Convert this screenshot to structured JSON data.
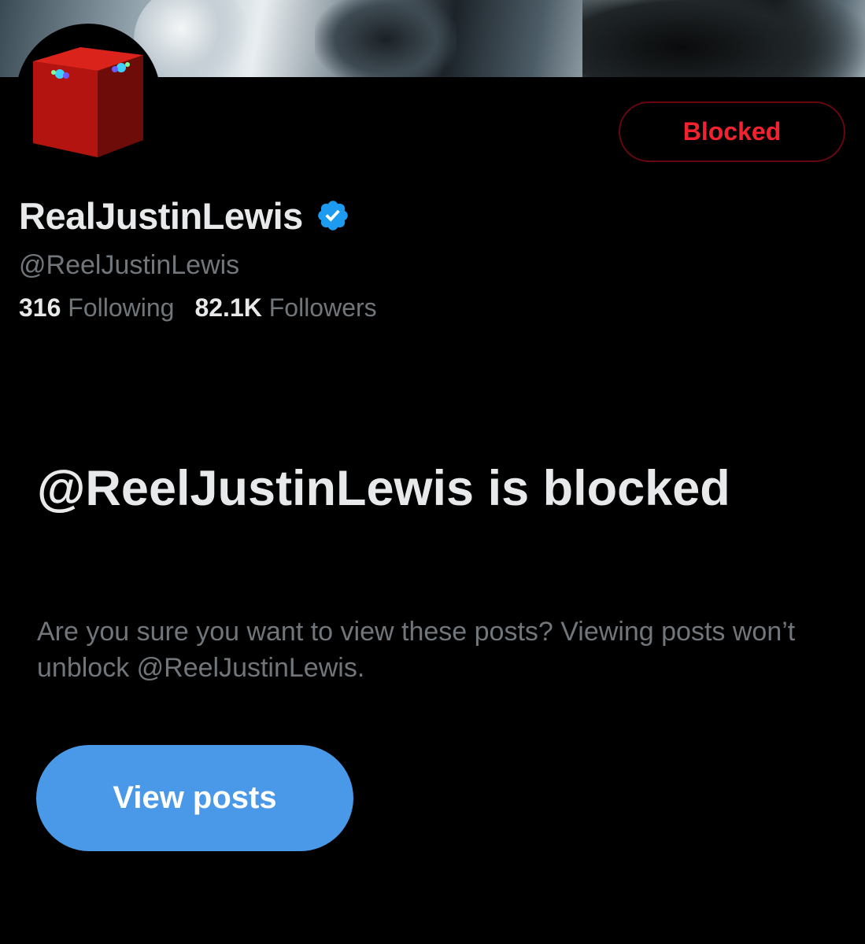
{
  "profile": {
    "display_name": "RealJustinLewis",
    "handle": "@ReelJustinLewis",
    "verified_icon": "verified-badge-icon",
    "avatar_icon": "red-cube-avatar",
    "following_count": "316",
    "following_label": "Following",
    "followers_count": "82.1K",
    "followers_label": "Followers"
  },
  "actions": {
    "blocked_label": "Blocked",
    "view_posts_label": "View posts"
  },
  "block_notice": {
    "title": "@ReelJustinLewis is blocked",
    "description": "Are you sure you want to view these posts? Viewing posts won’t unblock @ReelJustinLewis."
  },
  "colors": {
    "background": "#000000",
    "primary_text": "#e7e9ea",
    "secondary_text": "#71767b",
    "blocked_red": "#f4212e",
    "accent_blue": "#4a99e9",
    "verified_blue": "#1d9bf0"
  }
}
